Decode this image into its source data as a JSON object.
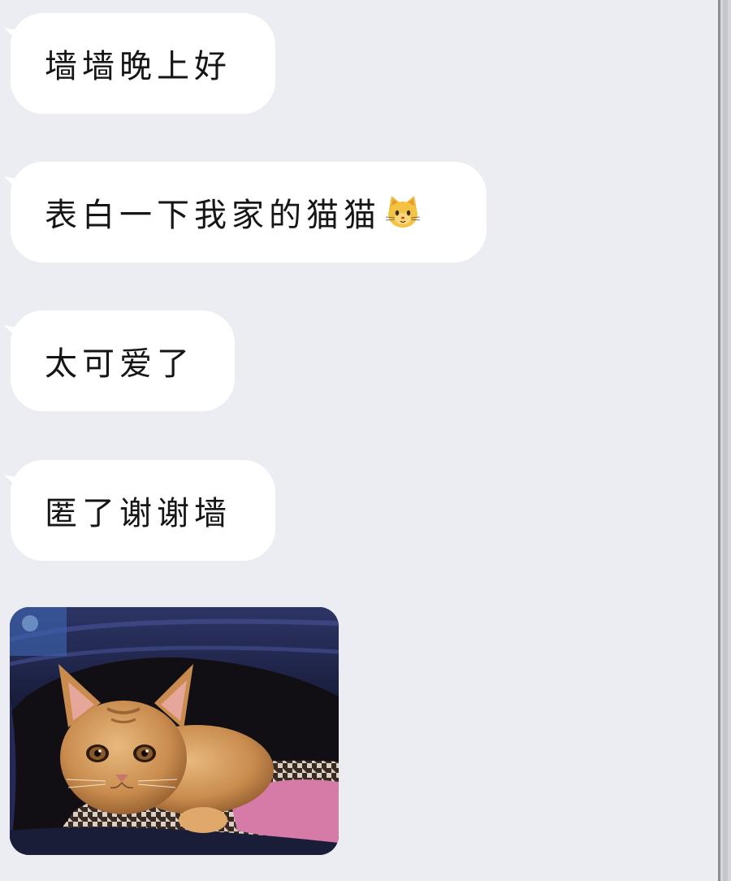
{
  "messages": [
    {
      "text": "墙墙晚上好"
    },
    {
      "text": "表白一下我家的猫猫"
    },
    {
      "text": "太可爱了"
    },
    {
      "text": "匿了谢谢墙"
    }
  ],
  "emoji": {
    "name": "cat-face-emoji",
    "color": "#f5c342"
  },
  "photo": {
    "subject": "orange-kitten-photo"
  },
  "colors": {
    "background": "#ebedf2",
    "bubble": "#ffffff",
    "text": "#161616",
    "scrollbar": "#c5c6cb"
  }
}
